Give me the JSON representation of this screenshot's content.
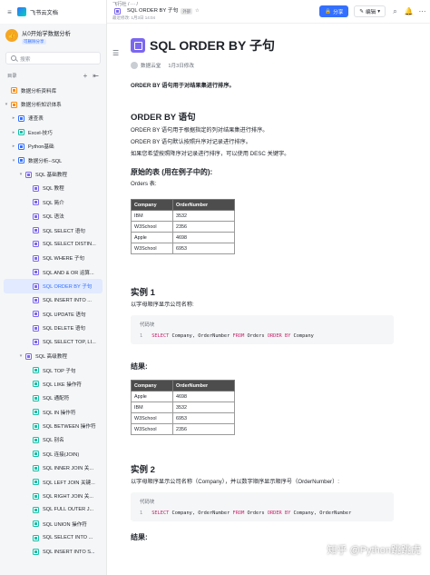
{
  "app": {
    "name": "飞书云文档"
  },
  "space": {
    "title": "从0开始学数据分析",
    "badge": "可删除分享"
  },
  "sidebar": {
    "search_placeholder": "搜索",
    "toc_label": "目录",
    "items": [
      {
        "label": "数据分析资料库",
        "depth": 0,
        "caret": "",
        "icon": "orange"
      },
      {
        "label": "数据分析知识体系",
        "depth": 0,
        "caret": "▾",
        "icon": "orange"
      },
      {
        "label": "速查表",
        "depth": 1,
        "caret": "▸",
        "icon": "blue"
      },
      {
        "label": "Excel-技巧",
        "depth": 1,
        "caret": "▸",
        "icon": "teal"
      },
      {
        "label": "Python基础",
        "depth": 1,
        "caret": "▸",
        "icon": "blue"
      },
      {
        "label": "数据分析--SQL",
        "depth": 1,
        "caret": "▾",
        "icon": "blue"
      },
      {
        "label": "SQL 基础教程",
        "depth": 2,
        "caret": "▾",
        "icon": "purple"
      },
      {
        "label": "SQL 教程",
        "depth": 3,
        "caret": "",
        "icon": "purple"
      },
      {
        "label": "SQL 简介",
        "depth": 3,
        "caret": "",
        "icon": "purple"
      },
      {
        "label": "SQL 语法",
        "depth": 3,
        "caret": "",
        "icon": "purple"
      },
      {
        "label": "SQL SELECT 语句",
        "depth": 3,
        "caret": "",
        "icon": "purple"
      },
      {
        "label": "SQL SELECT DISTIN...",
        "depth": 3,
        "caret": "",
        "icon": "purple"
      },
      {
        "label": "SQL WHERE 子句",
        "depth": 3,
        "caret": "",
        "icon": "purple"
      },
      {
        "label": "SQL AND & OR 运算...",
        "depth": 3,
        "caret": "",
        "icon": "purple"
      },
      {
        "label": "SQL ORDER BY 子句",
        "depth": 3,
        "caret": "",
        "icon": "purple",
        "active": true
      },
      {
        "label": "SQL INSERT INTO ...",
        "depth": 3,
        "caret": "",
        "icon": "purple"
      },
      {
        "label": "SQL UPDATE 语句",
        "depth": 3,
        "caret": "",
        "icon": "purple"
      },
      {
        "label": "SQL DELETE 语句",
        "depth": 3,
        "caret": "",
        "icon": "purple"
      },
      {
        "label": "SQL SELECT TOP, LI...",
        "depth": 3,
        "caret": "",
        "icon": "purple"
      },
      {
        "label": "SQL 高级教程",
        "depth": 2,
        "caret": "▾",
        "icon": "purple"
      },
      {
        "label": "SQL TOP 子句",
        "depth": 3,
        "caret": "",
        "icon": "teal"
      },
      {
        "label": "SQL LIKE 操作符",
        "depth": 3,
        "caret": "",
        "icon": "teal"
      },
      {
        "label": "SQL 通配符",
        "depth": 3,
        "caret": "",
        "icon": "teal"
      },
      {
        "label": "SQL IN 操作符",
        "depth": 3,
        "caret": "",
        "icon": "teal"
      },
      {
        "label": "SQL BETWEEN 操作符",
        "depth": 3,
        "caret": "",
        "icon": "teal"
      },
      {
        "label": "SQL 别名",
        "depth": 3,
        "caret": "",
        "icon": "teal"
      },
      {
        "label": "SQL 连接(JOIN)",
        "depth": 3,
        "caret": "",
        "icon": "teal"
      },
      {
        "label": "SQL INNER JOIN 关...",
        "depth": 3,
        "caret": "",
        "icon": "teal"
      },
      {
        "label": "SQL LEFT JOIN 关键...",
        "depth": 3,
        "caret": "",
        "icon": "teal"
      },
      {
        "label": "SQL RIGHT JOIN 关...",
        "depth": 3,
        "caret": "",
        "icon": "teal"
      },
      {
        "label": "SQL FULL OUTER J...",
        "depth": 3,
        "caret": "",
        "icon": "teal"
      },
      {
        "label": "SQL UNION 操作符",
        "depth": 3,
        "caret": "",
        "icon": "teal"
      },
      {
        "label": "SQL SELECT INTO ...",
        "depth": 3,
        "caret": "",
        "icon": "teal"
      },
      {
        "label": "SQL INSERT INTO S...",
        "depth": 3,
        "caret": "",
        "icon": "teal"
      }
    ]
  },
  "header": {
    "crumb_parent": "飞行社",
    "crumb_sep": "/ ··· /",
    "title": "SQL ORDER BY 子句",
    "tag": "外部",
    "subtitle": "最近修改: 1月3日 14:04",
    "share_label": "分享",
    "edit_label": "编辑"
  },
  "doc": {
    "title": "SQL ORDER BY 子句",
    "author": "数据云堂",
    "modified": "1月3日修改",
    "intro": "ORDER BY 语句用于对结果集进行排序。",
    "s1_title": "ORDER BY 语句",
    "s1_p1": "ORDER BY 语句用于根据指定的列对结果集进行排序。",
    "s1_p2": "ORDER BY 语句默认按照升序对记录进行排序。",
    "s1_p3": "如果您希望按照降序对记录进行排序，可以使用 DESC 关键字。",
    "s2_title": "原始的表 (用在例子中的):",
    "s2_label": "Orders 表:",
    "table1": {
      "headers": [
        "Company",
        "OrderNumber"
      ],
      "rows": [
        [
          "IBM",
          "3532"
        ],
        [
          "W3School",
          "2356"
        ],
        [
          "Apple",
          "4698"
        ],
        [
          "W3School",
          "6953"
        ]
      ]
    },
    "ex1_title": "实例 1",
    "ex1_desc": "以字母顺序显示公司名称:",
    "code_label": "代码块",
    "code1": {
      "ln": "1",
      "select": "SELECT",
      "cols": " Company, OrderNumber ",
      "from": "FROM",
      "tbl": " Orders ",
      "order": "ORDER BY",
      "col": " Company"
    },
    "result_title": "结果:",
    "table2": {
      "headers": [
        "Company",
        "OrderNumber"
      ],
      "rows": [
        [
          "Apple",
          "4698"
        ],
        [
          "IBM",
          "3532"
        ],
        [
          "W3School",
          "6953"
        ],
        [
          "W3School",
          "2356"
        ]
      ]
    },
    "ex2_title": "实例 2",
    "ex2_desc": "以字母顺序显示公司名称（Company），并以数字顺序显示顺序号（OrderNumber）:",
    "code2": {
      "ln": "1",
      "select": "SELECT",
      "cols": " Company, OrderNumber ",
      "from": "FROM",
      "tbl": " Orders ",
      "order": "ORDER BY",
      "col": " Company, OrderNumber"
    },
    "result2_title": "结果:"
  },
  "watermark": "知乎 @Python跳跳虎"
}
